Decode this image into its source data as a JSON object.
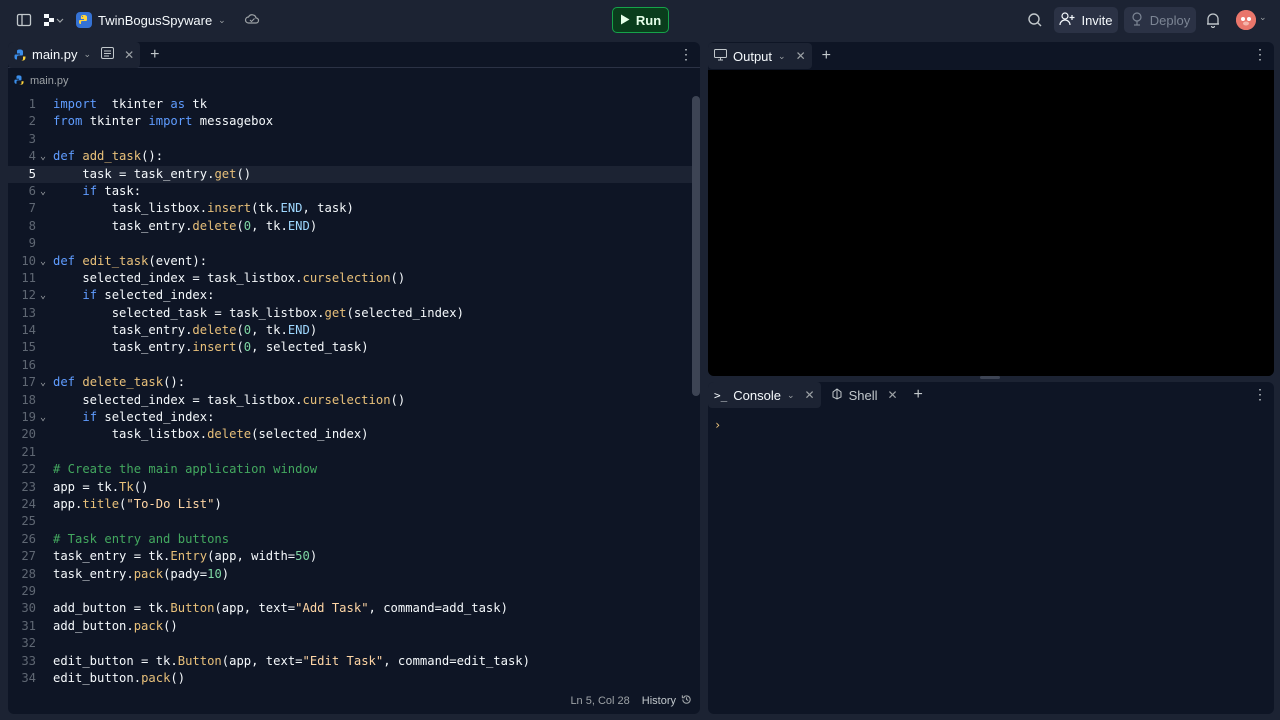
{
  "topbar": {
    "project_name": "TwinBogusSpyware",
    "run_label": "Run",
    "invite_label": "Invite",
    "deploy_label": "Deploy"
  },
  "editor": {
    "tab_label": "main.py",
    "breadcrumb": "main.py",
    "current_line": 5,
    "lines": [
      {
        "n": "1",
        "fold": false
      },
      {
        "n": "2",
        "fold": false
      },
      {
        "n": "3",
        "fold": false
      },
      {
        "n": "4",
        "fold": true
      },
      {
        "n": "5",
        "fold": false
      },
      {
        "n": "6",
        "fold": true
      },
      {
        "n": "7",
        "fold": false
      },
      {
        "n": "8",
        "fold": false
      },
      {
        "n": "9",
        "fold": false
      },
      {
        "n": "10",
        "fold": true
      },
      {
        "n": "11",
        "fold": false
      },
      {
        "n": "12",
        "fold": true
      },
      {
        "n": "13",
        "fold": false
      },
      {
        "n": "14",
        "fold": false
      },
      {
        "n": "15",
        "fold": false
      },
      {
        "n": "16",
        "fold": false
      },
      {
        "n": "17",
        "fold": true
      },
      {
        "n": "18",
        "fold": false
      },
      {
        "n": "19",
        "fold": true
      },
      {
        "n": "20",
        "fold": false
      },
      {
        "n": "21",
        "fold": false
      },
      {
        "n": "22",
        "fold": false
      },
      {
        "n": "23",
        "fold": false
      },
      {
        "n": "24",
        "fold": false
      },
      {
        "n": "25",
        "fold": false
      },
      {
        "n": "26",
        "fold": false
      },
      {
        "n": "27",
        "fold": false
      },
      {
        "n": "28",
        "fold": false
      },
      {
        "n": "29",
        "fold": false
      },
      {
        "n": "30",
        "fold": false
      },
      {
        "n": "31",
        "fold": false
      },
      {
        "n": "32",
        "fold": false
      },
      {
        "n": "33",
        "fold": false
      },
      {
        "n": "34",
        "fold": false
      }
    ],
    "code": [
      [
        [
          "kw",
          "import"
        ],
        [
          "",
          "  tkinter "
        ],
        [
          "kw",
          "as"
        ],
        [
          "",
          " tk"
        ]
      ],
      [
        [
          "kw",
          "from"
        ],
        [
          "",
          " tkinter "
        ],
        [
          "kw",
          "import"
        ],
        [
          "",
          " messagebox"
        ]
      ],
      [],
      [
        [
          "kw",
          "def"
        ],
        [
          "",
          " "
        ],
        [
          "fn",
          "add_task"
        ],
        [
          "",
          "():"
        ]
      ],
      [
        [
          "",
          "    task = task_entry."
        ],
        [
          "fn",
          "get"
        ],
        [
          "",
          "()"
        ]
      ],
      [
        [
          "",
          "    "
        ],
        [
          "kw",
          "if"
        ],
        [
          "",
          " task:"
        ]
      ],
      [
        [
          "",
          "        task_listbox."
        ],
        [
          "fn",
          "insert"
        ],
        [
          "",
          "(tk."
        ],
        [
          "attr",
          "END"
        ],
        [
          "",
          ", task)"
        ]
      ],
      [
        [
          "",
          "        task_entry."
        ],
        [
          "fn",
          "delete"
        ],
        [
          "",
          "("
        ],
        [
          "num",
          "0"
        ],
        [
          "",
          ", tk."
        ],
        [
          "attr",
          "END"
        ],
        [
          "",
          ")"
        ]
      ],
      [],
      [
        [
          "kw",
          "def"
        ],
        [
          "",
          " "
        ],
        [
          "fn",
          "edit_task"
        ],
        [
          "",
          "(event):"
        ]
      ],
      [
        [
          "",
          "    selected_index = task_listbox."
        ],
        [
          "fn",
          "curselection"
        ],
        [
          "",
          "()"
        ]
      ],
      [
        [
          "",
          "    "
        ],
        [
          "kw",
          "if"
        ],
        [
          "",
          " selected_index:"
        ]
      ],
      [
        [
          "",
          "        selected_task = task_listbox."
        ],
        [
          "fn",
          "get"
        ],
        [
          "",
          "(selected_index)"
        ]
      ],
      [
        [
          "",
          "        task_entry."
        ],
        [
          "fn",
          "delete"
        ],
        [
          "",
          "("
        ],
        [
          "num",
          "0"
        ],
        [
          "",
          ", tk."
        ],
        [
          "attr",
          "END"
        ],
        [
          "",
          ")"
        ]
      ],
      [
        [
          "",
          "        task_entry."
        ],
        [
          "fn",
          "insert"
        ],
        [
          "",
          "("
        ],
        [
          "num",
          "0"
        ],
        [
          "",
          ", selected_task)"
        ]
      ],
      [],
      [
        [
          "kw",
          "def"
        ],
        [
          "",
          " "
        ],
        [
          "fn",
          "delete_task"
        ],
        [
          "",
          "():"
        ]
      ],
      [
        [
          "",
          "    selected_index = task_listbox."
        ],
        [
          "fn",
          "curselection"
        ],
        [
          "",
          "()"
        ]
      ],
      [
        [
          "",
          "    "
        ],
        [
          "kw",
          "if"
        ],
        [
          "",
          " selected_index:"
        ]
      ],
      [
        [
          "",
          "        task_listbox."
        ],
        [
          "fn",
          "delete"
        ],
        [
          "",
          "(selected_index)"
        ]
      ],
      [],
      [
        [
          "cm",
          "# Create the main application window"
        ]
      ],
      [
        [
          "",
          "app = tk."
        ],
        [
          "fn",
          "Tk"
        ],
        [
          "",
          "()"
        ]
      ],
      [
        [
          "",
          "app."
        ],
        [
          "fn",
          "title"
        ],
        [
          "",
          "("
        ],
        [
          "str",
          "\"To-Do List\""
        ],
        [
          "",
          ")"
        ]
      ],
      [],
      [
        [
          "cm",
          "# Task entry and buttons"
        ]
      ],
      [
        [
          "",
          "task_entry = tk."
        ],
        [
          "fn",
          "Entry"
        ],
        [
          "",
          "(app, width="
        ],
        [
          "num",
          "50"
        ],
        [
          "",
          ")"
        ]
      ],
      [
        [
          "",
          "task_entry."
        ],
        [
          "fn",
          "pack"
        ],
        [
          "",
          "(pady="
        ],
        [
          "num",
          "10"
        ],
        [
          "",
          ")"
        ]
      ],
      [],
      [
        [
          "",
          "add_button = tk."
        ],
        [
          "fn",
          "Button"
        ],
        [
          "",
          "(app, text="
        ],
        [
          "str",
          "\"Add Task\""
        ],
        [
          "",
          ", command=add_task)"
        ]
      ],
      [
        [
          "",
          "add_button."
        ],
        [
          "fn",
          "pack"
        ],
        [
          "",
          "()"
        ]
      ],
      [],
      [
        [
          "",
          "edit_button = tk."
        ],
        [
          "fn",
          "Button"
        ],
        [
          "",
          "(app, text="
        ],
        [
          "str",
          "\"Edit Task\""
        ],
        [
          "",
          ", command=edit_task)"
        ]
      ],
      [
        [
          "",
          "edit_button."
        ],
        [
          "fn",
          "pack"
        ],
        [
          "",
          "()"
        ]
      ]
    ],
    "status_position": "Ln 5, Col 28",
    "history_label": "History"
  },
  "output": {
    "tab_label": "Output"
  },
  "console": {
    "tab_console": "Console",
    "tab_shell": "Shell",
    "prompt": "›"
  }
}
